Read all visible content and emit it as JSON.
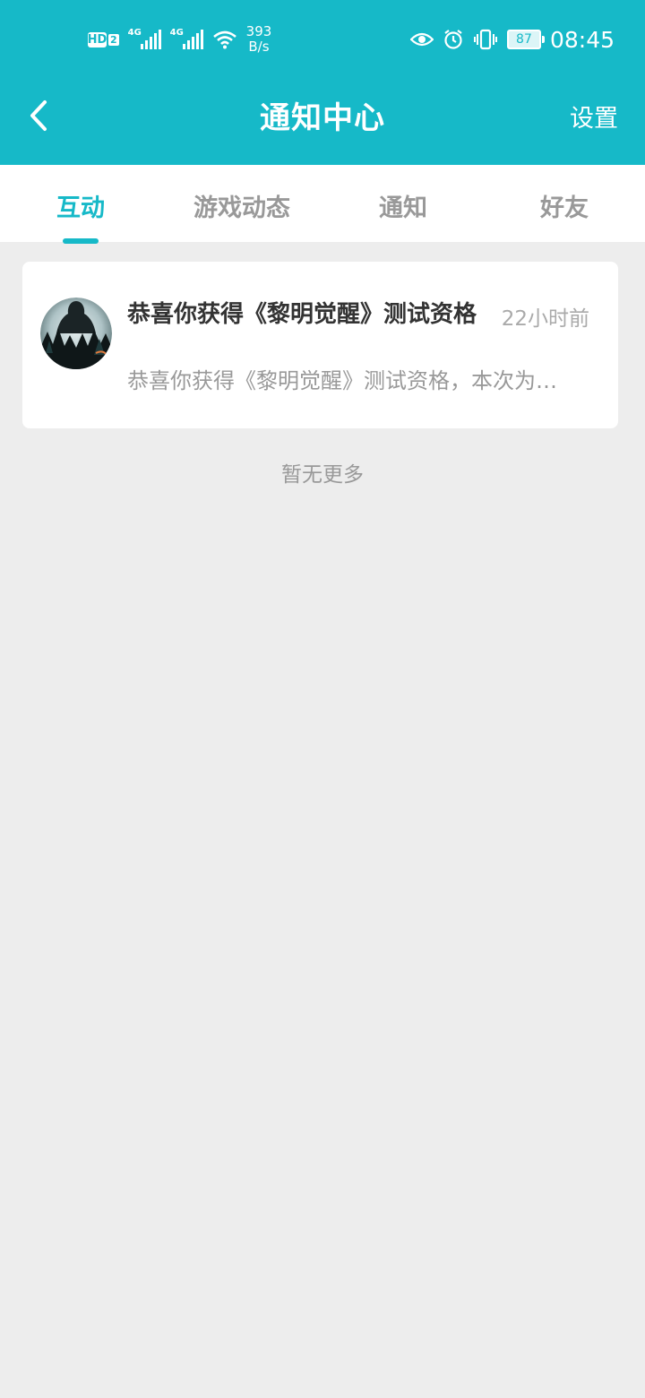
{
  "status_bar": {
    "hd_label": "HD",
    "hd_sub": "2",
    "net1": "4G",
    "net2": "4G",
    "speed_value": "393",
    "speed_unit": "B/s",
    "battery": "87",
    "time": "08:45"
  },
  "header": {
    "title": "通知中心",
    "settings_label": "设置"
  },
  "tabs": [
    {
      "label": "互动",
      "active": true
    },
    {
      "label": "游戏动态",
      "active": false
    },
    {
      "label": "通知",
      "active": false
    },
    {
      "label": "好友",
      "active": false
    }
  ],
  "notifications": [
    {
      "title": "恭喜你获得《黎明觉醒》测试资格",
      "time": "22小时前",
      "preview": "恭喜你获得《黎明觉醒》测试资格，本次为…"
    }
  ],
  "footer_text": "暂无更多",
  "colors": {
    "accent": "#16b9c8",
    "background": "#ededed"
  }
}
